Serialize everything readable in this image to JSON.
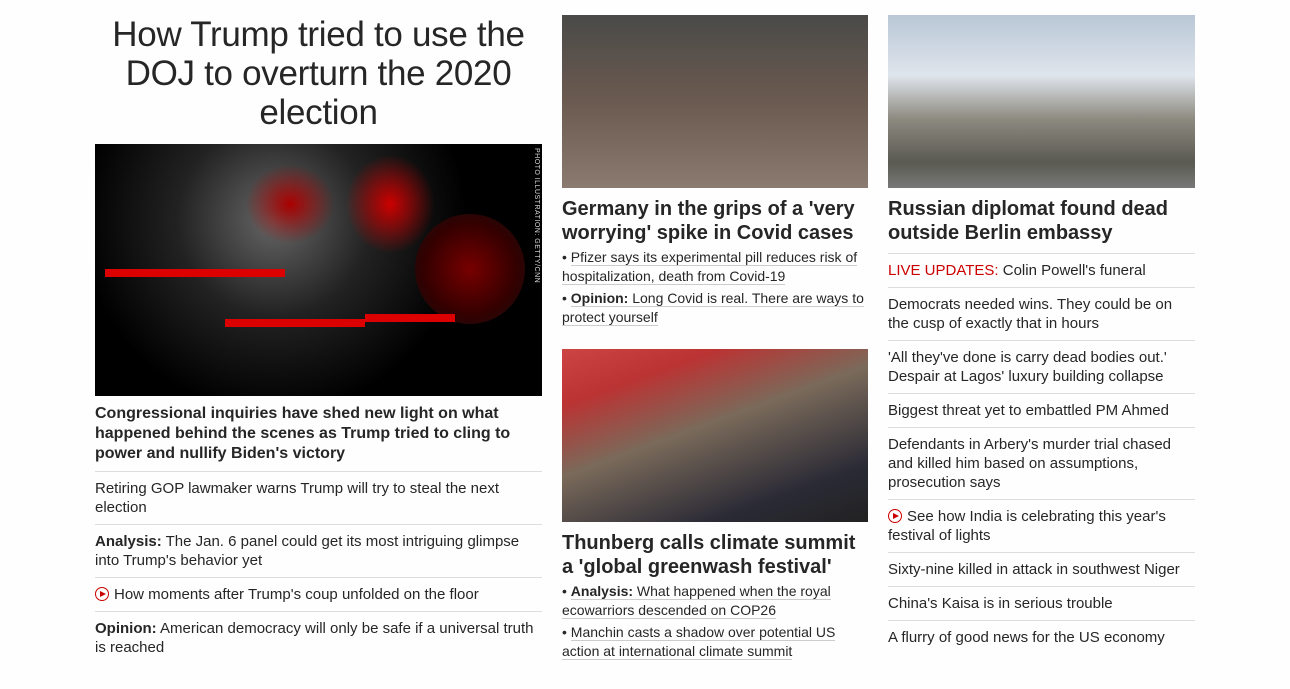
{
  "col1": {
    "headline": "How Trump tried to use the DOJ to overturn the 2020 election",
    "photo_credit": "PHOTO ILLUSTRATION: GETTY/CNN",
    "lead": "Congressional inquiries have shed new light on what happened behind the scenes as Trump tried to cling to power and nullify Biden's victory",
    "items": [
      {
        "prefix": "",
        "text": "Retiring GOP lawmaker warns Trump will try to steal the next election"
      },
      {
        "prefix": "Analysis:",
        "text": " The Jan. 6 panel could get its most intriguing glimpse into Trump's behavior yet"
      },
      {
        "prefix": "",
        "text": "How moments after Trump's coup unfolded on the floor",
        "icon": "play-icon"
      },
      {
        "prefix": "Opinion:",
        "text": " American democracy will only be safe if a universal truth is reached"
      }
    ]
  },
  "col2": {
    "story1": {
      "headline": "Germany in the grips of a 'very worrying' spike in Covid cases",
      "subs": [
        {
          "prefix": "",
          "text": "Pfizer says its experimental pill reduces risk of hospitalization, death from Covid-19"
        },
        {
          "prefix": "Opinion:",
          "text": " Long Covid is real. There are ways to protect yourself"
        }
      ]
    },
    "story2": {
      "headline": "Thunberg calls climate summit a 'global greenwash festival'",
      "subs": [
        {
          "prefix": "Analysis:",
          "text": " What happened when the royal ecowarriors descended on COP26"
        },
        {
          "prefix": "",
          "text": "Manchin casts a shadow over potential US action at international climate summit"
        }
      ]
    }
  },
  "col3": {
    "headline": "Russian diplomat found dead outside Berlin embassy",
    "items": [
      {
        "live": "LIVE UPDATES:",
        "text": " Colin Powell's funeral"
      },
      {
        "text": "Democrats needed wins. They could be on the cusp of exactly that in hours"
      },
      {
        "text": "'All they've done is carry dead bodies out.' Despair at Lagos' luxury building collapse"
      },
      {
        "text": "Biggest threat yet to embattled PM Ahmed"
      },
      {
        "text": "Defendants in Arbery's murder trial chased and killed him based on assumptions, prosecution says"
      },
      {
        "text": "See how India is celebrating this year's festival of lights",
        "icon": "play-icon"
      },
      {
        "text": "Sixty-nine killed in attack in southwest Niger"
      },
      {
        "text": "China's Kaisa is in serious trouble"
      },
      {
        "text": "A flurry of good news for the US economy"
      }
    ]
  },
  "colors": {
    "accent": "#cc0000",
    "text": "#262626",
    "divider": "#dddddd"
  }
}
